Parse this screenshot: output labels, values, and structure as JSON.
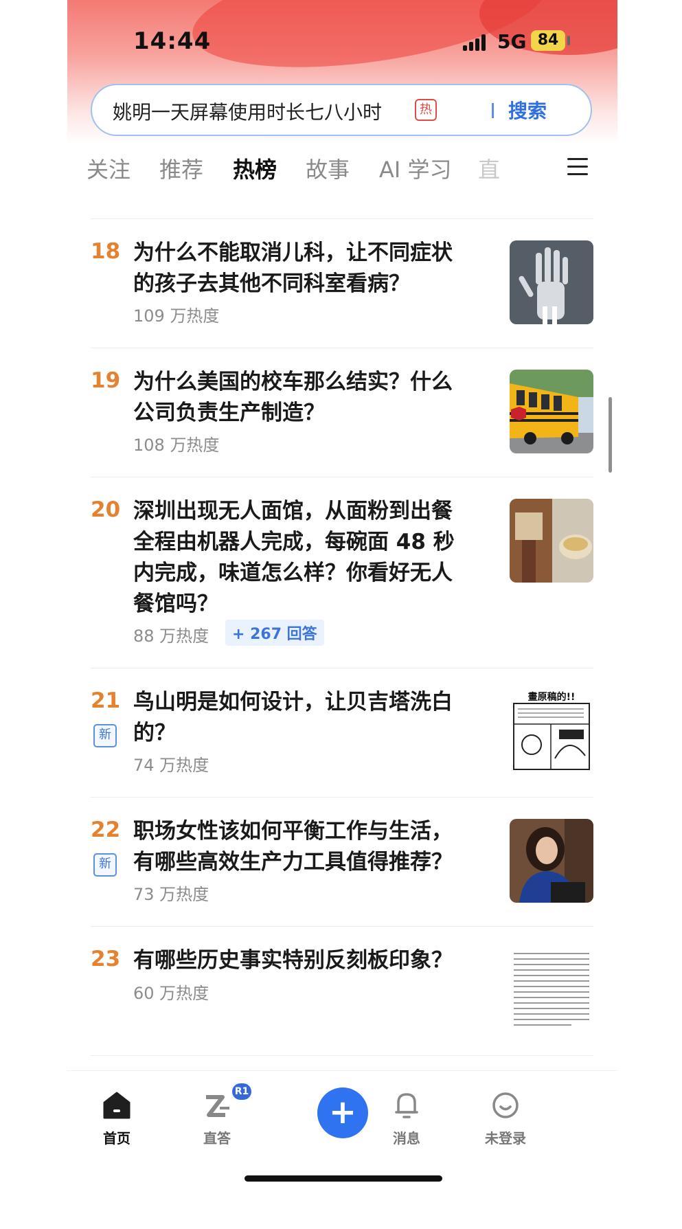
{
  "status_bar": {
    "time": "14:44",
    "network": "5G",
    "battery": "84"
  },
  "search": {
    "query": "姚明一天屏幕使用时长七八小时",
    "hot_badge": "热",
    "button": "搜索"
  },
  "tabs": [
    {
      "label": "关注"
    },
    {
      "label": "推荐"
    },
    {
      "label": "热榜"
    },
    {
      "label": "故事"
    },
    {
      "label": "AI 学习"
    },
    {
      "label": "直"
    }
  ],
  "active_tab": "热榜",
  "hot_list": [
    {
      "rank": "18",
      "title": "为什么不能取消儿科，让不同症状的孩子去其他不同科室看病？",
      "heat": "109 万热度",
      "thumb": "xray-hand-image"
    },
    {
      "rank": "19",
      "title": "为什么美国的校车那么结实？什么公司负责生产制造？",
      "heat": "108 万热度",
      "thumb": "school-bus-image"
    },
    {
      "rank": "20",
      "title": "深圳出现无人面馆，从面粉到出餐全程由机器人完成，每碗面 48 秒内完成，味道怎么样？你看好无人餐馆吗？",
      "heat": "88 万热度",
      "answers": "+ 267 回答",
      "thumb": "noodle-shop-image"
    },
    {
      "rank": "21",
      "badge": "新",
      "title": "鸟山明是如何设计，让贝吉塔洗白的？",
      "heat": "74 万热度",
      "thumb": "manga-draft-image",
      "thumb_text": "畫原稿的!!"
    },
    {
      "rank": "22",
      "badge": "新",
      "title": "职场女性该如何平衡工作与生活，有哪些高效生产力工具值得推荐？",
      "heat": "73 万热度",
      "thumb": "woman-portrait-image"
    },
    {
      "rank": "23",
      "title": "有哪些历史事实特别反刻板印象？",
      "heat": "60 万热度",
      "thumb": "text-document-image"
    }
  ],
  "bottom_nav": [
    {
      "label": "首页",
      "icon": "home-icon"
    },
    {
      "label": "直答",
      "icon": "zhida-icon",
      "badge": "R1"
    },
    {
      "label": "",
      "icon": "plus-icon"
    },
    {
      "label": "消息",
      "icon": "bell-icon"
    },
    {
      "label": "未登录",
      "icon": "smile-icon"
    }
  ],
  "colors": {
    "accent": "#2f73f0",
    "rank": "#e5822f",
    "hot_red": "#e24b45"
  }
}
